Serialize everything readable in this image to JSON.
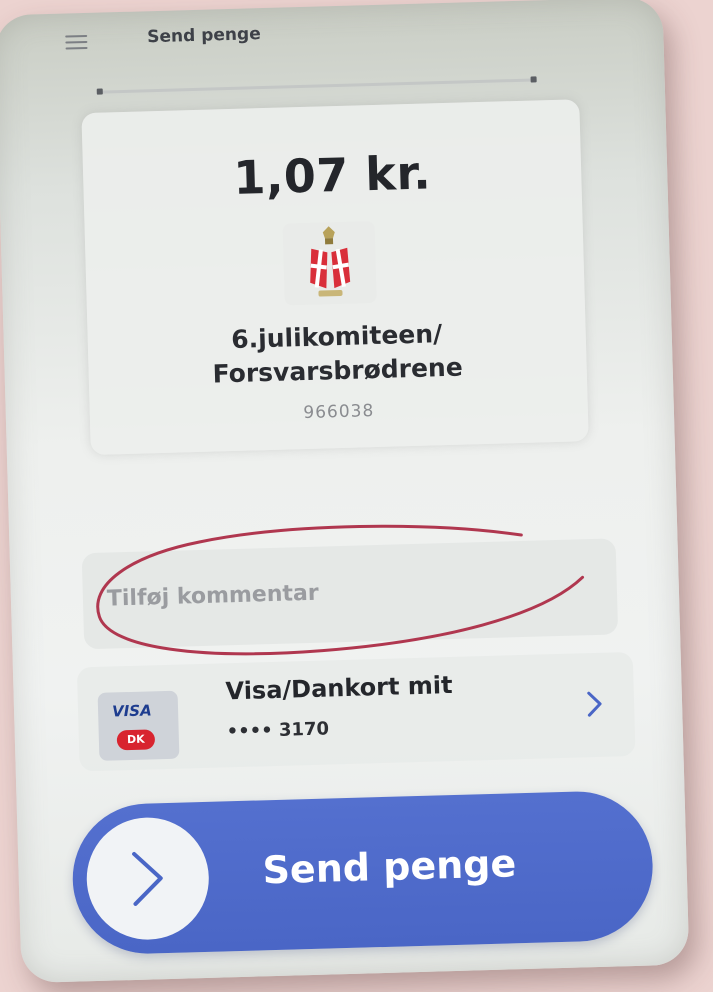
{
  "header": {
    "title": "Send penge",
    "menu_icon": "hamburger-menu-icon"
  },
  "recipient": {
    "amount": "1,07 kr.",
    "name_line1": "6.julikomiteen/",
    "name_line2": "Forsvarsbrødrene",
    "id": "966038",
    "logo": "danish-flag-crest-icon"
  },
  "comment": {
    "placeholder": "Tilføj kommentar"
  },
  "payment": {
    "brand_visa": "VISA",
    "brand_dk": "DK",
    "card_name": "Visa/Dankort mit",
    "card_number": "•••• 3170",
    "chevron": "chevron-right-icon"
  },
  "send_button": {
    "label": "Send penge",
    "icon": "chevron-right-icon"
  },
  "colors": {
    "accent": "#4f6bcb",
    "annotation": "#b0374f",
    "dankort_red": "#d8242f"
  }
}
